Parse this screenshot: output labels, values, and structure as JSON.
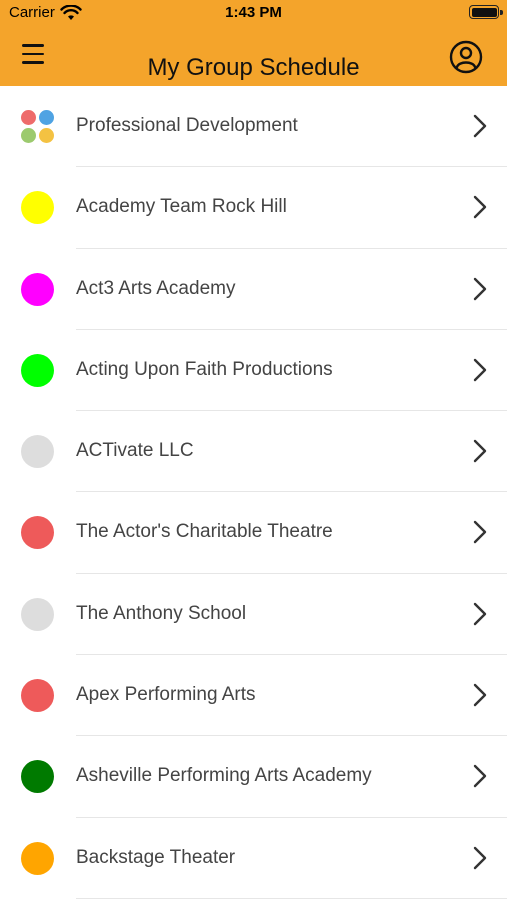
{
  "status_bar": {
    "carrier": "Carrier",
    "time": "1:43 PM"
  },
  "header": {
    "title": "My Group Schedule",
    "menu_icon": "hamburger-menu-icon",
    "profile_icon": "user-circle-icon",
    "background_color": "#f4a42b"
  },
  "groups": [
    {
      "label": "Professional Development",
      "color": "multi",
      "multi_colors": [
        "#ee6b6b",
        "#4fa3e3",
        "#9cca6e",
        "#f4c242"
      ]
    },
    {
      "label": "Academy Team Rock Hill",
      "color": "#ffff00"
    },
    {
      "label": "Act3 Arts Academy",
      "color": "#ff00ff"
    },
    {
      "label": "Acting Upon Faith Productions",
      "color": "#00ff00"
    },
    {
      "label": "ACTivate LLC",
      "color": "#dddddd"
    },
    {
      "label": "The Actor's Charitable Theatre",
      "color": "#ee5a5a"
    },
    {
      "label": "The Anthony School",
      "color": "#dddddd"
    },
    {
      "label": "Apex Performing Arts",
      "color": "#ee5a5a"
    },
    {
      "label": "Asheville Performing Arts Academy",
      "color": "#007a00"
    },
    {
      "label": "Backstage Theater",
      "color": "#ffa500"
    }
  ]
}
